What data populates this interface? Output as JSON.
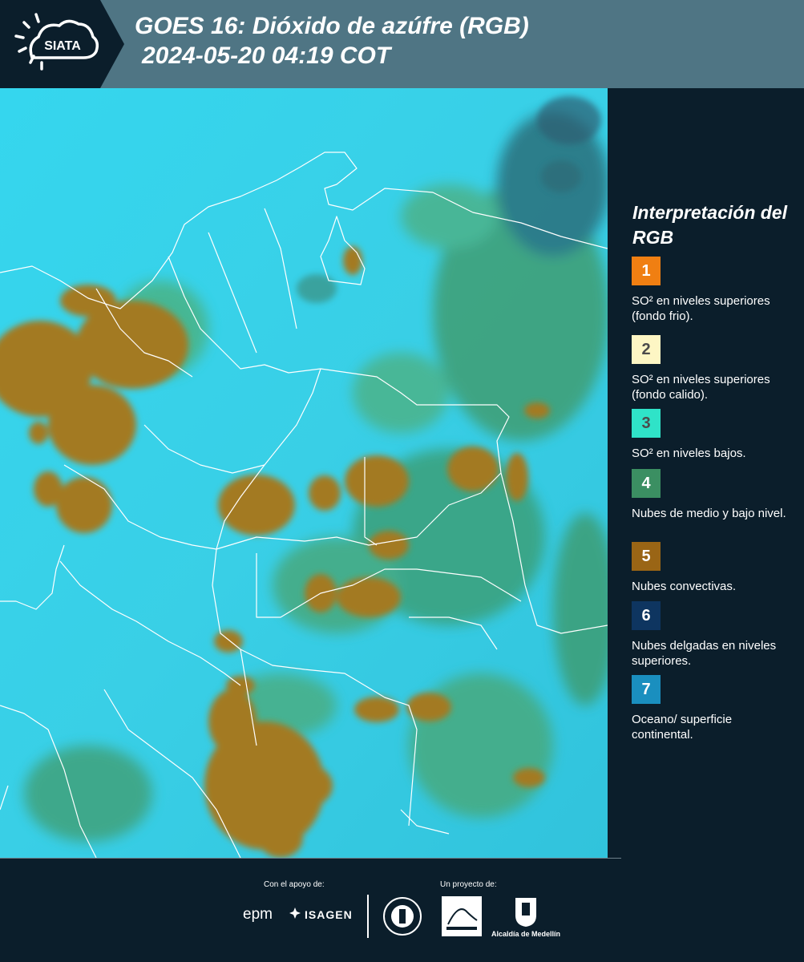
{
  "header": {
    "logo_text": "SIATA",
    "title_line1": "GOES 16: Dióxido de azúfre (RGB)",
    "title_line2": "2024-05-20 04:19 COT"
  },
  "map": {
    "icon": "satellite-map-image",
    "colors": {
      "background": "#2fd4e8",
      "thick_cloud": "#a57a22",
      "low_cloud": "#3aa06a",
      "boundary": "#ffffff"
    }
  },
  "legend": {
    "title": "Interpretación del RGB",
    "items": [
      {
        "number": "1",
        "color": "#f07f12",
        "text": "SO² en niveles superiores (fondo frio)."
      },
      {
        "number": "2",
        "color": "#fdf6c4",
        "text": "SO² en niveles superiores (fondo calido)."
      },
      {
        "number": "3",
        "color": "#2fe3c8",
        "text": "SO² en niveles bajos."
      },
      {
        "number": "4",
        "color": "#3b8f62",
        "text": "Nubes de medio y bajo nivel."
      },
      {
        "number": "5",
        "color": "#9a6515",
        "text": "Nubes convectivas."
      },
      {
        "number": "6",
        "color": "#0e3560",
        "text": "Nubes delgadas en niveles superiores."
      },
      {
        "number": "7",
        "color": "#1a8fbf",
        "text": "Oceano/ superficie continental."
      }
    ]
  },
  "footer": {
    "support_label": "Con el apoyo de:",
    "project_label": "Un proyecto de:",
    "sponsor_epm": "epm",
    "sponsor_isagen": "ISAGEN",
    "alcaldia": "Alcaldía de Medellín"
  }
}
